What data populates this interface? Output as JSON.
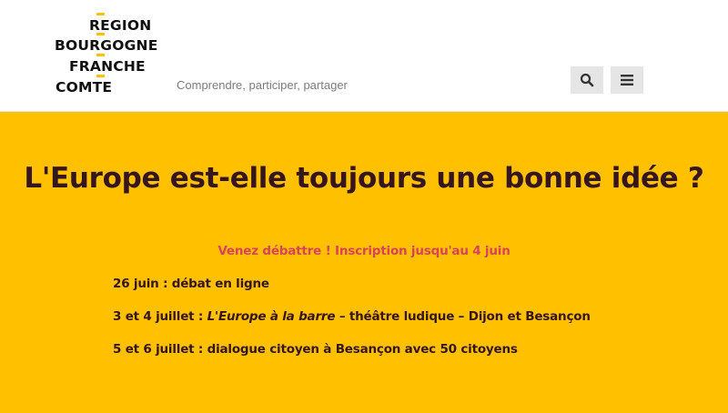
{
  "header": {
    "logo_lines": [
      "REGION",
      "BOURGOGNE",
      "FRANCHE",
      "COMTE"
    ],
    "tagline": "Comprendre, participer, partager",
    "search_icon": "search-icon",
    "menu_icon": "hamburger-menu-icon"
  },
  "hero": {
    "title": "L'Europe est-elle toujours une bonne idée ?",
    "subtitle": "Venez débattre ! Inscription jusqu'au 4 juin",
    "events": [
      {
        "date": "26 juin :",
        "text": "débat en ligne"
      },
      {
        "date": "3 et 4 juillet :",
        "italic": "L'Europe à la barre",
        "text": "– théâtre ludique – Dijon et Besançon"
      },
      {
        "date": "5 et 6 juillet :",
        "text": "dialogue citoyen à Besançon avec 50 citoyens"
      }
    ]
  },
  "colors": {
    "hero_background": "#ffc000",
    "title_text": "#35161e",
    "subtitle_text": "#d8435a",
    "logo_accent": "#ffc000",
    "button_background": "#e5e5e5"
  }
}
